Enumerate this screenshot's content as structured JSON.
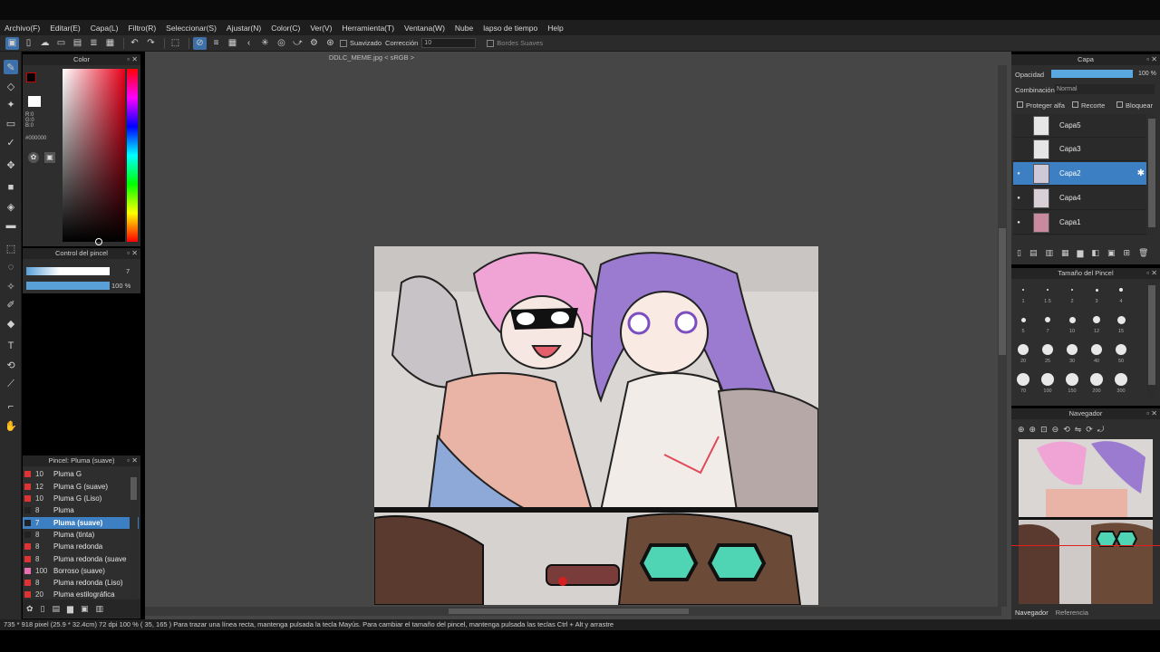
{
  "menu": [
    "Archivo(F)",
    "Editar(E)",
    "Capa(L)",
    "Filtro(R)",
    "Seleccionar(S)",
    "Ajustar(N)",
    "Color(C)",
    "Ver(V)",
    "Herramienta(T)",
    "Ventana(W)",
    "Nube",
    "lapso de tiempo",
    "Help"
  ],
  "toolbar": {
    "smooth_label": "Suavizado",
    "correction_label": "Corrección",
    "correction_value": "10",
    "soft_edges_label": "Bordes Suaves"
  },
  "color_panel": {
    "title": "Color",
    "r": "R:0",
    "g": "G:0",
    "b": "B:0",
    "hex": "#000000"
  },
  "brush_control": {
    "title": "Control del pincel",
    "size": "7",
    "opacity": "100 %"
  },
  "brush_list": {
    "title": "Pincel: Pluma (suave)",
    "items": [
      {
        "size": "10",
        "name": "Pluma G"
      },
      {
        "size": "12",
        "name": "Pluma G (suave)"
      },
      {
        "size": "10",
        "name": "Pluma G (Liso)"
      },
      {
        "size": "8",
        "name": "Pluma"
      },
      {
        "size": "7",
        "name": "Pluma (suave)"
      },
      {
        "size": "8",
        "name": "Pluma (tinta)"
      },
      {
        "size": "8",
        "name": "Pluma redonda"
      },
      {
        "size": "8",
        "name": "Pluma redonda (suave"
      },
      {
        "size": "100",
        "name": "Borroso (suave)"
      },
      {
        "size": "8",
        "name": "Pluma redonda (Liso)"
      },
      {
        "size": "20",
        "name": "Pluma estilográfica"
      }
    ]
  },
  "document": {
    "title": "DDLC_MEME.jpg < sRGB >"
  },
  "layer_panel": {
    "title": "Capa",
    "opacity_label": "Opacidad",
    "opacity_value": "100 %",
    "opacity_fraction": 1.0,
    "blend_label": "Combinación",
    "blend_value": "Normal",
    "protect_alpha": "Proteger alfa",
    "clipping": "Recorte",
    "lock": "Bloquear",
    "layers": [
      {
        "name": "Capa5",
        "visible": false,
        "selected": false
      },
      {
        "name": "Capa3",
        "visible": false,
        "selected": false
      },
      {
        "name": "Capa2",
        "visible": true,
        "selected": true
      },
      {
        "name": "Capa4",
        "visible": true,
        "selected": false
      },
      {
        "name": "Capa1",
        "visible": true,
        "selected": false
      }
    ]
  },
  "brush_size_panel": {
    "title": "Tamaño del Pincel",
    "sizes": [
      "1",
      "1.5",
      "2",
      "3",
      "4",
      "5",
      "7",
      "10",
      "12",
      "15",
      "20",
      "25",
      "30",
      "40",
      "50",
      "70",
      "100",
      "150",
      "200",
      "300"
    ]
  },
  "navigator": {
    "title": "Navegador",
    "tab_navigator": "Navegador",
    "tab_reference": "Referencia"
  },
  "status": {
    "text": "735 * 918 pixel  (25.9 * 32.4cm)  72 dpi  100 %  ( 35, 165 )  Para trazar una línea recta, mantenga pulsada la tecla Mayús. Para cambiar el tamaño del pincel, mantenga pulsada las teclas Ctrl + Alt y arrastre"
  }
}
